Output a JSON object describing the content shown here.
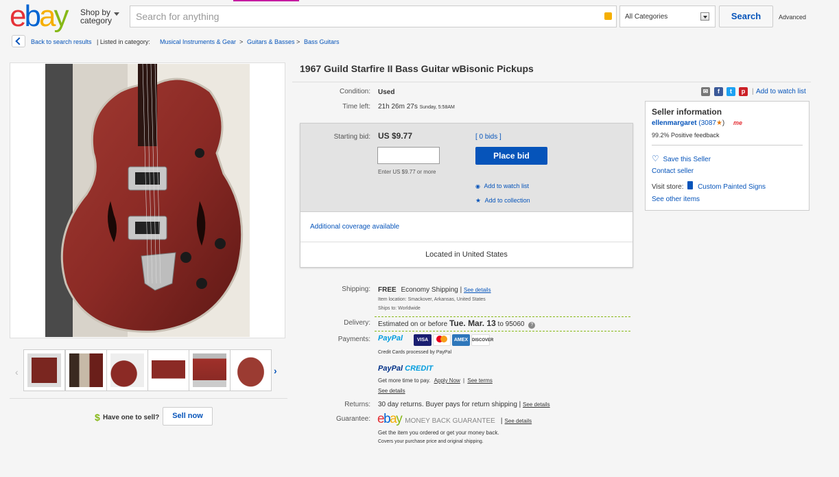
{
  "header": {
    "logo": [
      "e",
      "b",
      "a",
      "y"
    ],
    "shop_by_line1": "Shop by",
    "shop_by_line2": "category",
    "search_placeholder": "Search for anything",
    "category_select": "All Categories",
    "search_button": "Search",
    "advanced": "Advanced"
  },
  "breadcrumb": {
    "back": "Back to search results",
    "listed_in": "| Listed in category:",
    "items": [
      "Musical Instruments & Gear",
      "Guitars & Basses",
      "Bass Guitars"
    ],
    "separator": ">"
  },
  "listing": {
    "title": "1967 Guild Starfire II Bass Guitar wBisonic Pickups",
    "condition_label": "Condition:",
    "condition_value": "Used",
    "time_left_label": "Time left:",
    "time_left_value": "21h 26m 27s",
    "time_left_end": "Sunday, 5:58AM"
  },
  "share": {
    "icons": [
      "email-icon",
      "facebook-icon",
      "twitter-icon",
      "pinterest-icon"
    ],
    "watch_list": "Add to watch list"
  },
  "bid": {
    "starting_label": "Starting bid:",
    "starting_value": "US $9.77",
    "bids": "[ 0 bids ]",
    "hint": "Enter US $9.77 or more",
    "place_bid": "Place bid",
    "add_watch": "Add to watch list",
    "add_collection": "Add to collection",
    "coverage": "Additional coverage available",
    "located": "Located in United States"
  },
  "seller": {
    "heading": "Seller information",
    "name": "ellenmargaret",
    "feedback_count": "(3087",
    "feedback_close": ")",
    "me_badge": "me",
    "positive": "99.2% Positive feedback",
    "save": "Save this Seller",
    "contact": "Contact seller",
    "visit_store": "Visit store:",
    "store_name": "Custom Painted Signs",
    "other_items": "See other items"
  },
  "shipping": {
    "label": "Shipping:",
    "free": "FREE",
    "method": "Economy Shipping |",
    "see_details": "See details",
    "item_location": "Item location:  Smackover, Arkansas, United States",
    "ships_to": "Ships to:  Worldwide"
  },
  "delivery": {
    "label": "Delivery:",
    "text_before": "Estimated on or before",
    "date": "Tue. Mar. 13",
    "text_after": "to 95060",
    "help_icon": "?"
  },
  "payments": {
    "label": "Payments:",
    "paypal": "PayPal",
    "cards": [
      "VISA",
      "MC",
      "AMEX",
      "DISCOVER"
    ],
    "processed": "Credit Cards processed by PayPal",
    "paypal_credit_1": "PayPal",
    "paypal_credit_2": "CREDIT",
    "more_time": "Get more time to pay.",
    "apply_now": "Apply Now",
    "pipe": "|",
    "see_terms": "See terms",
    "see_details": "See details"
  },
  "returns": {
    "label": "Returns:",
    "text": "30 day returns. Buyer pays for return shipping |",
    "see_details": "See details"
  },
  "guarantee": {
    "label": "Guarantee:",
    "logo": [
      "e",
      "b",
      "a",
      "y"
    ],
    "money_back": "MONEY BACK GUARANTEE",
    "pipe": "|",
    "see_details": "See details",
    "line1": "Get the item you ordered or get your money back.",
    "line2": "Covers your purchase price and original shipping."
  },
  "sell": {
    "dollar": "$",
    "question": "Have one to sell?",
    "button": "Sell now"
  },
  "colors": {
    "link": "#0654ba",
    "guitar_body": "#8b2a25",
    "place_bid_bg": "#0654ba",
    "paypal_dark": "#003087",
    "paypal_light": "#009cde"
  }
}
